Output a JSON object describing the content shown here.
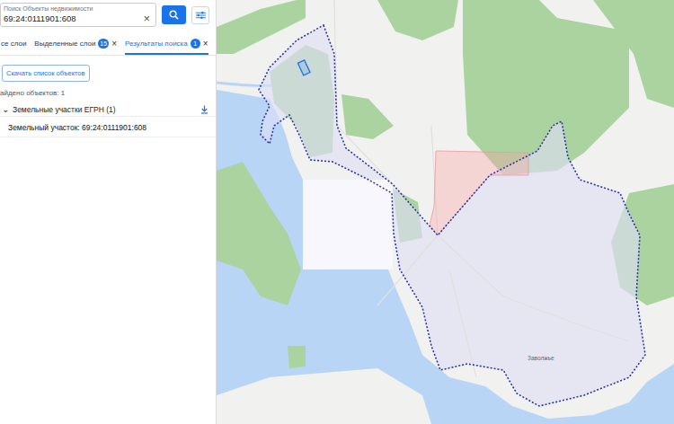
{
  "search": {
    "label": "Поиск Объекты недвижимости",
    "value": "69:24:0111901:608",
    "clear": "×"
  },
  "tabs": [
    {
      "label": "се слои",
      "selected": false
    },
    {
      "label": "Выделенные слои",
      "badge": "15",
      "close": "×",
      "selected": false
    },
    {
      "label": "Результаты поиска",
      "badge": "1",
      "close": "×",
      "selected": true
    }
  ],
  "download_button": "Скачать список объектов",
  "found": "айдено объектов: 1",
  "group": {
    "chevron": "⌄",
    "title": "Земельные участки ЕГРН (1)",
    "expanded": true
  },
  "results": [
    {
      "label": "Земельный участок: 69:24:0111901:608"
    }
  ],
  "map": {
    "settlement_label": "Заволжье"
  }
}
